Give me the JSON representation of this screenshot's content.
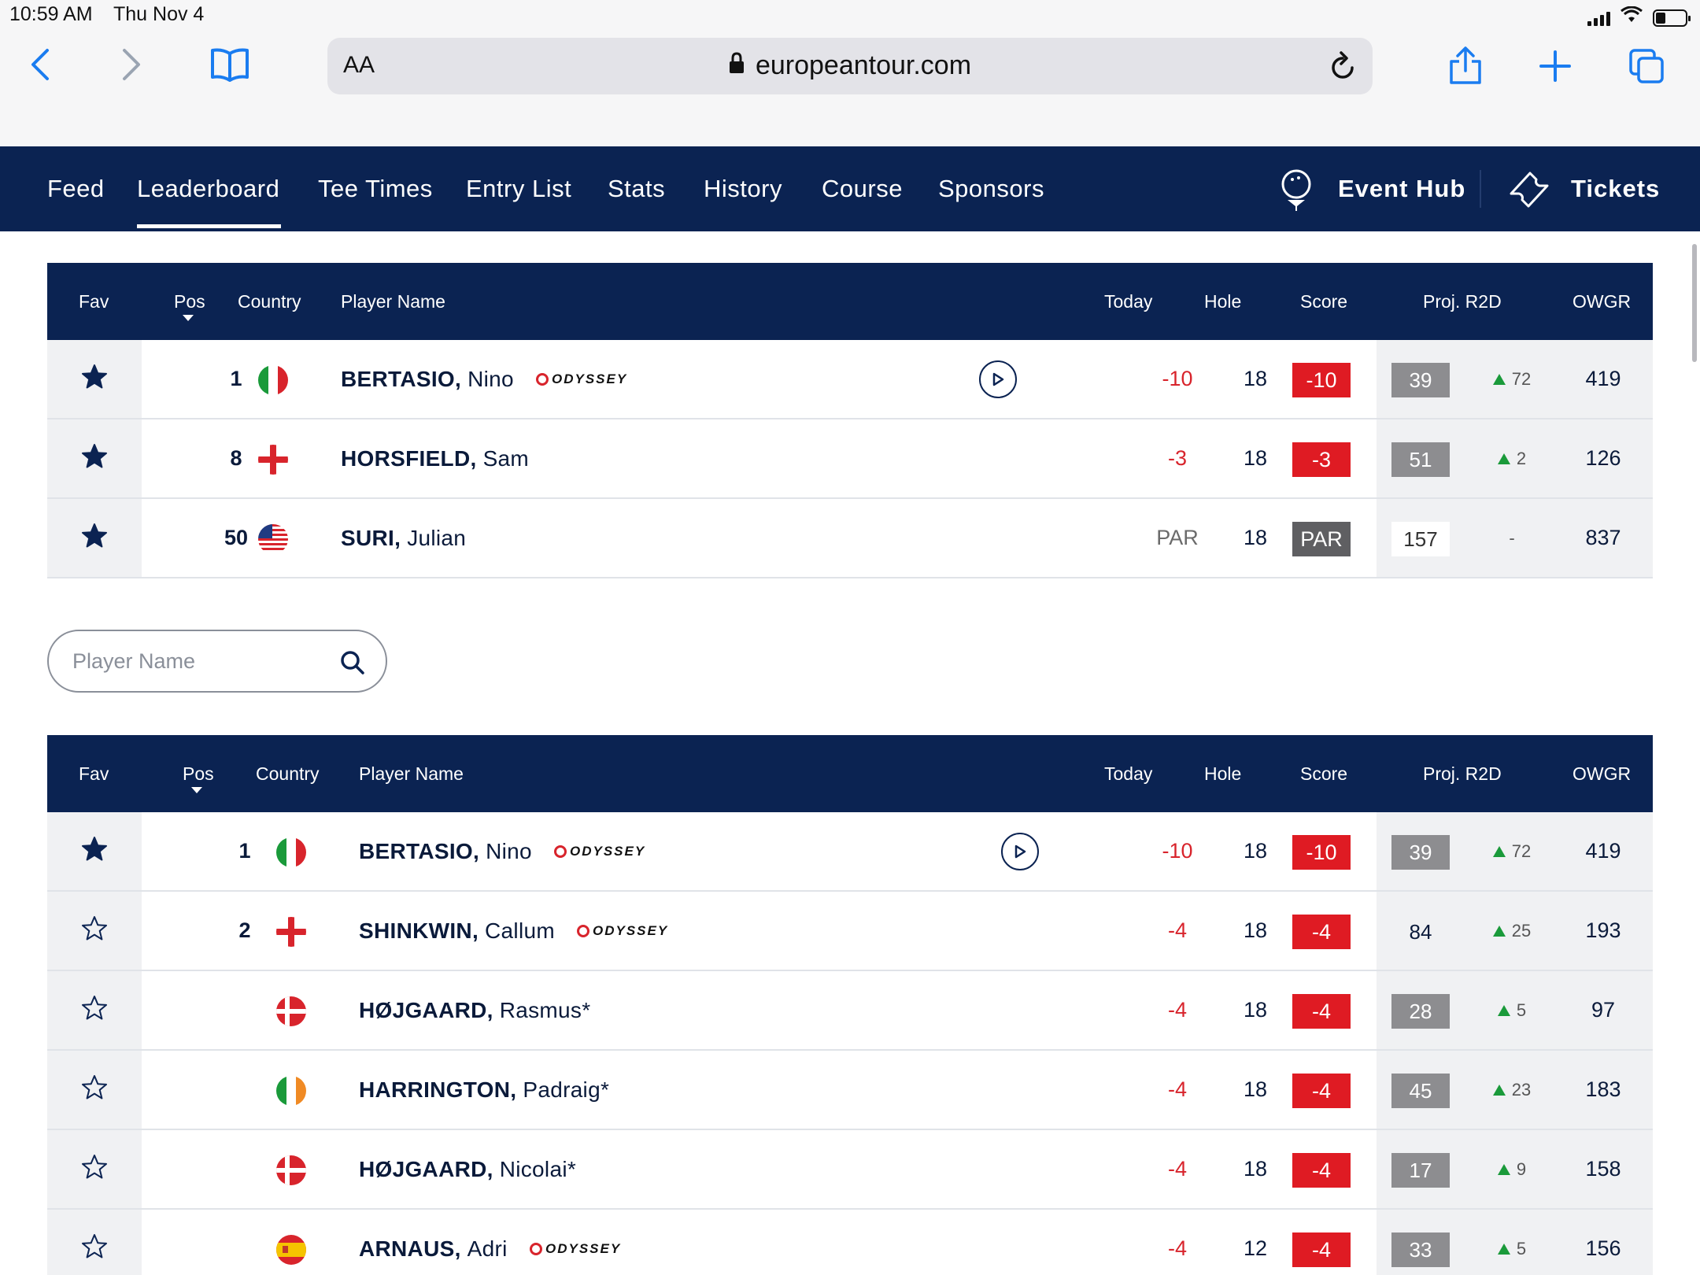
{
  "status_bar": {
    "time": "10:59 AM",
    "date": "Thu Nov 4"
  },
  "browser": {
    "url_text_size_label": "AA",
    "url": "europeantour.com",
    "icons": [
      "back-icon",
      "forward-icon",
      "bookmarks-icon",
      "lock-icon",
      "reload-icon",
      "share-icon",
      "new-tab-icon",
      "tabs-icon"
    ]
  },
  "nav": {
    "items": [
      "Feed",
      "Leaderboard",
      "Tee Times",
      "Entry List",
      "Stats",
      "History",
      "Course",
      "Sponsors"
    ],
    "active": "Leaderboard",
    "event_hub_label": "Event Hub",
    "tickets_label": "Tickets"
  },
  "columns": {
    "fav": "Fav",
    "pos": "Pos",
    "country": "Country",
    "player": "Player Name",
    "today": "Today",
    "hole": "Hole",
    "score": "Score",
    "proj": "Proj. R2D",
    "owgr": "OWGR"
  },
  "sponsor_label": "ODYSSEY",
  "favourites": [
    {
      "fav": true,
      "pos": "1",
      "flag": "italy",
      "surname": "BERTASIO,",
      "first": "Nino",
      "sponsor": true,
      "video": true,
      "today": "-10",
      "hole": "18",
      "score": "-10",
      "proj": "39",
      "move": "72",
      "owgr": "419"
    },
    {
      "fav": true,
      "pos": "8",
      "flag": "england",
      "surname": "HORSFIELD,",
      "first": "Sam",
      "sponsor": false,
      "video": false,
      "today": "-3",
      "hole": "18",
      "score": "-3",
      "proj": "51",
      "move": "2",
      "owgr": "126"
    },
    {
      "fav": true,
      "pos": "50",
      "flag": "usa",
      "surname": "SURI,",
      "first": "Julian",
      "sponsor": false,
      "video": false,
      "today": "PAR",
      "hole": "18",
      "score": "PAR",
      "proj": "157",
      "move": "-",
      "owgr": "837"
    }
  ],
  "search": {
    "placeholder": "Player Name"
  },
  "leaderboard": [
    {
      "fav": true,
      "pos": "1",
      "flag": "italy",
      "surname": "BERTASIO,",
      "first": "Nino",
      "sponsor": true,
      "video": true,
      "today": "-10",
      "hole": "18",
      "score": "-10",
      "proj": "39",
      "move": "72",
      "owgr": "419"
    },
    {
      "fav": false,
      "pos": "2",
      "flag": "england",
      "surname": "SHINKWIN,",
      "first": "Callum",
      "sponsor": true,
      "video": false,
      "today": "-4",
      "hole": "18",
      "score": "-4",
      "proj": "84",
      "move": "25",
      "owgr": "193"
    },
    {
      "fav": false,
      "pos": "",
      "flag": "denmark",
      "surname": "HØJGAARD,",
      "first": "Rasmus*",
      "sponsor": false,
      "video": false,
      "today": "-4",
      "hole": "18",
      "score": "-4",
      "proj": "28",
      "move": "5",
      "owgr": "97"
    },
    {
      "fav": false,
      "pos": "",
      "flag": "ireland",
      "surname": "HARRINGTON,",
      "first": "Padraig*",
      "sponsor": false,
      "video": false,
      "today": "-4",
      "hole": "18",
      "score": "-4",
      "proj": "45",
      "move": "23",
      "owgr": "183"
    },
    {
      "fav": false,
      "pos": "",
      "flag": "denmark",
      "surname": "HØJGAARD,",
      "first": "Nicolai*",
      "sponsor": false,
      "video": false,
      "today": "-4",
      "hole": "18",
      "score": "-4",
      "proj": "17",
      "move": "9",
      "owgr": "158"
    },
    {
      "fav": false,
      "pos": "",
      "flag": "spain",
      "surname": "ARNAUS,",
      "first": "Adri",
      "sponsor": true,
      "video": false,
      "today": "-4",
      "hole": "12",
      "score": "-4",
      "proj": "33",
      "move": "5",
      "owgr": "156"
    }
  ],
  "colors": {
    "navy": "#0b2352",
    "red": "#df1b23",
    "green": "#1a9a3a",
    "grey_badge": "#8d8d90",
    "par_badge": "#5f5f62"
  }
}
